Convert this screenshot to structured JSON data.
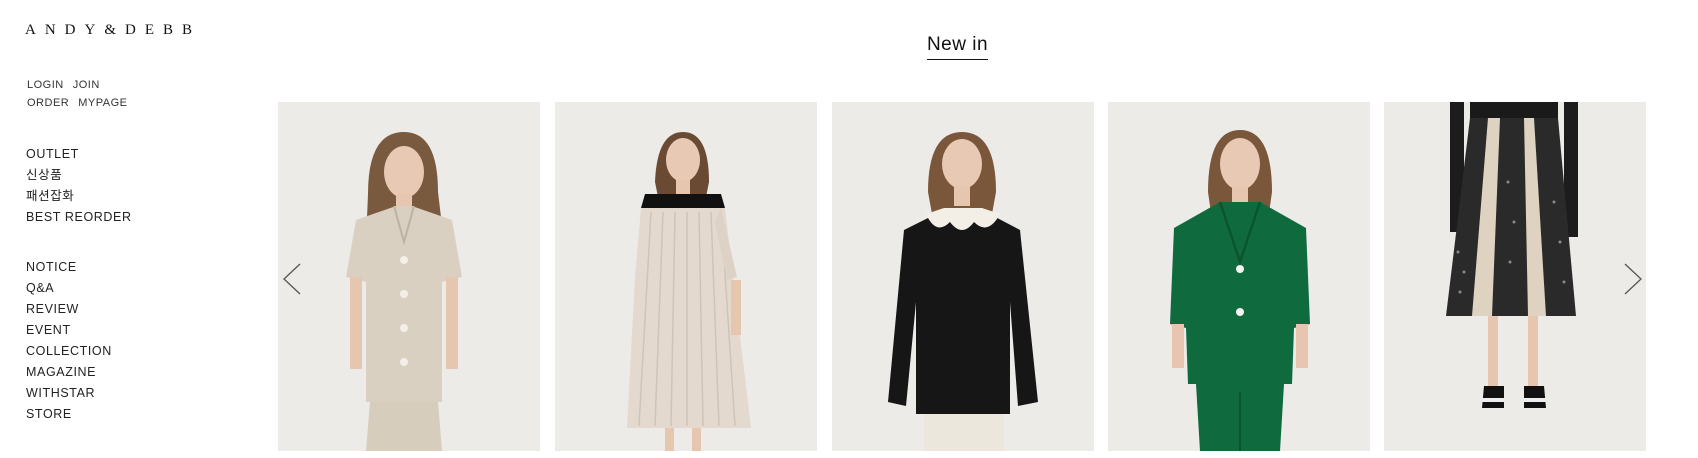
{
  "brand": {
    "logo_text": "ANDY&DEBB"
  },
  "header": {
    "login": "LOGIN",
    "join": "JOIN",
    "order": "ORDER",
    "mypage": "MYPAGE"
  },
  "menu_primary": [
    "OUTLET",
    "신상품",
    "패션잡화",
    "BEST REORDER"
  ],
  "menu_secondary": [
    "NOTICE",
    "Q&A",
    "REVIEW",
    "EVENT",
    "COLLECTION",
    "MAGAZINE",
    "WITHSTAR",
    "STORE"
  ],
  "section": {
    "title": "New in"
  },
  "products": [
    {
      "name": "beige short-sleeve button shirt and trousers",
      "main_color": "#d9d0c1"
    },
    {
      "name": "pleated ivory dress with black yoke",
      "main_color": "#e3d9ce"
    },
    {
      "name": "black knit with scalloped white collar",
      "main_color": "#161616"
    },
    {
      "name": "green jacket and trousers set",
      "main_color": "#0f6a3d"
    },
    {
      "name": "patterned pleated midi skirt",
      "main_color": "#2a2a2a"
    }
  ],
  "carousel": {
    "prev_icon": "chevron-left-icon",
    "next_icon": "chevron-right-icon"
  },
  "colors": {
    "background": "#ffffff",
    "photo_background": "#ecebe7",
    "text": "#1a1a1a"
  }
}
